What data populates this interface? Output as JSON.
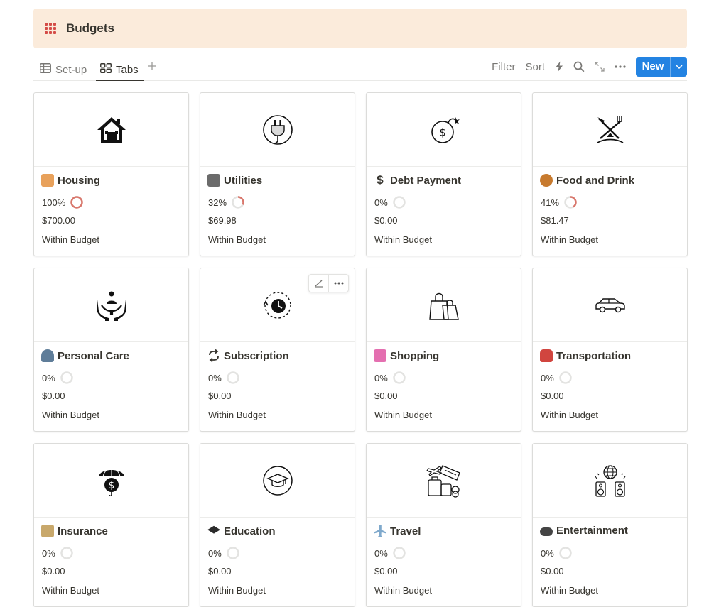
{
  "banner": {
    "title": "Budgets",
    "icon": "grid-icon",
    "accent": "#d44c47",
    "background": "#fbebdb"
  },
  "tabs": [
    {
      "label": "Set-up",
      "icon": "table-icon",
      "active": false
    },
    {
      "label": "Tabs",
      "icon": "gallery-icon",
      "active": true
    }
  ],
  "toolbar": {
    "filter_label": "Filter",
    "sort_label": "Sort",
    "new_label": "New",
    "accent": "#2383e2"
  },
  "cards": [
    {
      "name": "Housing",
      "emoji": "house-emoji",
      "cover_icon": "house-icon",
      "percent_label": "100%",
      "progress": 1.0,
      "amount": "$700.00",
      "status": "Within Budget"
    },
    {
      "name": "Utilities",
      "emoji": "plug-emoji",
      "cover_icon": "plug-icon",
      "percent_label": "32%",
      "progress": 0.32,
      "amount": "$69.98",
      "status": "Within Budget"
    },
    {
      "name": "Debt Payment",
      "emoji": "dollar-emoji",
      "cover_icon": "money-bomb-icon",
      "percent_label": "0%",
      "progress": 0,
      "amount": "$0.00",
      "status": "Within Budget"
    },
    {
      "name": "Food and Drink",
      "emoji": "food-emoji",
      "cover_icon": "fork-knife-icon",
      "percent_label": "41%",
      "progress": 0.41,
      "amount": "$81.47",
      "status": "Within Budget"
    },
    {
      "name": "Personal Care",
      "emoji": "person-emoji",
      "cover_icon": "care-hands-icon",
      "percent_label": "0%",
      "progress": 0,
      "amount": "$0.00",
      "status": "Within Budget"
    },
    {
      "name": "Subscription",
      "emoji": "repeat-emoji",
      "cover_icon": "renew-clock-icon",
      "percent_label": "0%",
      "progress": 0,
      "amount": "$0.00",
      "status": "Within Budget"
    },
    {
      "name": "Shopping",
      "emoji": "shopping-bags-emoji",
      "cover_icon": "shopping-bags-icon",
      "percent_label": "0%",
      "progress": 0,
      "amount": "$0.00",
      "status": "Within Budget"
    },
    {
      "name": "Transportation",
      "emoji": "car-emoji",
      "cover_icon": "car-icon",
      "percent_label": "0%",
      "progress": 0,
      "amount": "$0.00",
      "status": "Within Budget"
    },
    {
      "name": "Insurance",
      "emoji": "bank-emoji",
      "cover_icon": "umbrella-dollar-icon",
      "percent_label": "0%",
      "progress": 0,
      "amount": "$0.00",
      "status": "Within Budget"
    },
    {
      "name": "Education",
      "emoji": "grad-cap-emoji",
      "cover_icon": "grad-cap-icon",
      "percent_label": "0%",
      "progress": 0,
      "amount": "$0.00",
      "status": "Within Budget"
    },
    {
      "name": "Travel",
      "emoji": "airplane-emoji",
      "cover_icon": "travel-icon",
      "percent_label": "0%",
      "progress": 0,
      "amount": "$0.00",
      "status": "Within Budget"
    },
    {
      "name": "Entertainment",
      "emoji": "gamepad-emoji",
      "cover_icon": "speakers-globe-icon",
      "percent_label": "0%",
      "progress": 0,
      "amount": "$0.00",
      "status": "Within Budget"
    }
  ],
  "colors": {
    "progress_ring": "#d9776c",
    "ring_track": "#e3e3e1"
  }
}
